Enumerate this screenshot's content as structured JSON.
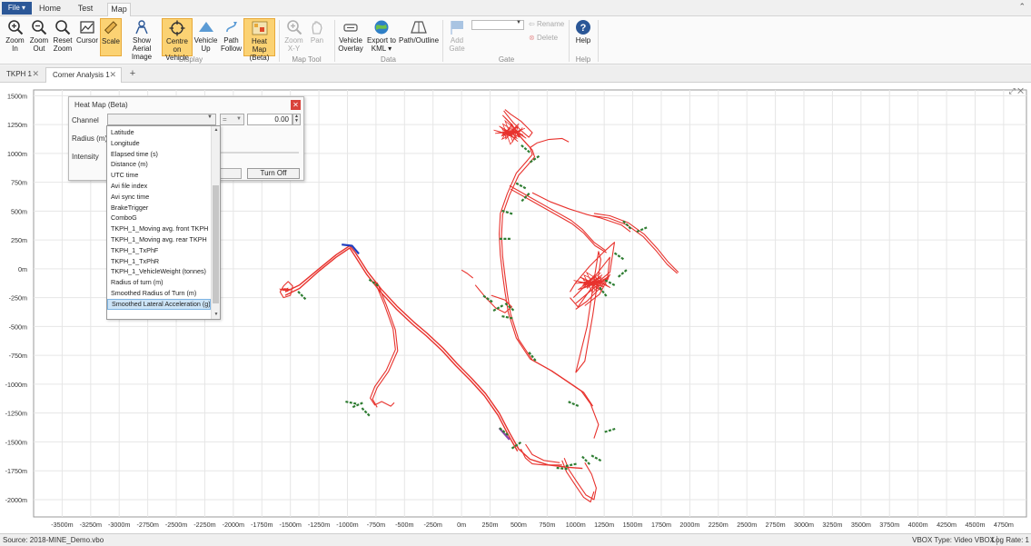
{
  "ribbon_tabs": {
    "file": "File ▾",
    "home": "Home",
    "test_setup": "Test Setup",
    "map": "Map",
    "collapse": "⌃"
  },
  "ribbon": {
    "zoom_in": [
      "Zoom",
      "In"
    ],
    "zoom_out": [
      "Zoom",
      "Out"
    ],
    "reset_zoom": [
      "Reset",
      "Zoom"
    ],
    "cursor": "Cursor",
    "scale": "Scale",
    "show_aerial": [
      "Show Aerial",
      "Image"
    ],
    "centre_on_vehicle": [
      "Centre on",
      "Vehicle"
    ],
    "vehicle_up": [
      "Vehicle",
      "Up"
    ],
    "path_follow": [
      "Path",
      "Follow"
    ],
    "heat_map": [
      "Heat Map",
      "(Beta)"
    ],
    "zoom_xy": [
      "Zoom",
      "X-Y"
    ],
    "pan": "Pan",
    "vehicle_overlay": [
      "Vehicle",
      "Overlay"
    ],
    "export_kml": [
      "Export to",
      "KML ▾"
    ],
    "path_outline": "Path/Outline",
    "add_gate": [
      "Add",
      "Gate"
    ],
    "rename": "Rename",
    "delete": "Delete",
    "help": "Help",
    "groups": {
      "display": "Display",
      "map_tool": "Map Tool",
      "data": "Data",
      "gate": "Gate",
      "help": "Help"
    }
  },
  "doc_tabs": {
    "tab1": "TKPH 1",
    "tab2": "Corner Analysis 1",
    "close": "✕",
    "add": "+"
  },
  "heat_map_dialog": {
    "title": "Heat Map (Beta)",
    "close": "✕",
    "channel_label": "Channel",
    "radius_label": "Radius (m)",
    "intensity_label": "Intensity",
    "operator": "=",
    "value": "0.00",
    "turn_off": "Turn Off"
  },
  "channel_options": [
    "Latitude",
    "Longitude",
    "Elapsed time (s)",
    "Distance (m)",
    "UTC time",
    "Avi file index",
    "Avi sync time",
    "BrakeTrigger",
    "ComboG",
    "TKPH_1_Moving avg. front TKPH",
    "TKPH_1_Moving avg. rear TKPH",
    "TKPH_1_TxPhF",
    "TKPH_1_TxPhR",
    "TKPH_1_VehicleWeight (tonnes)",
    "Radius of turn (m)",
    "Smoothed Radius of Turn (m)",
    "Smoothed Lateral Acceleration (g)"
  ],
  "selected_channel_index": 16,
  "map": {
    "x_axis_ticks": [
      "-3500m",
      "-3250m",
      "-3000m",
      "-2750m",
      "-2500m",
      "-2250m",
      "-2000m",
      "-1750m",
      "-1500m",
      "-1250m",
      "-1000m",
      "-750m",
      "-500m",
      "-250m",
      "0m",
      "250m",
      "500m",
      "750m",
      "1000m",
      "1250m",
      "1500m",
      "1750m",
      "2000m",
      "2250m",
      "2500m",
      "2750m",
      "3000m",
      "3250m",
      "3500m",
      "3750m",
      "4000m",
      "4250m",
      "4500m",
      "4750m"
    ],
    "y_axis_ticks": [
      "1500m",
      "1250m",
      "1000m",
      "750m",
      "500m",
      "250m",
      "0m",
      "-250m",
      "-500m",
      "-750m",
      "-1000m",
      "-1250m",
      "-1500m",
      "-1750m",
      "-2000m"
    ],
    "x_range": [
      -3750,
      4950
    ],
    "y_range": [
      -2150,
      1550
    ],
    "grid": true,
    "colors": {
      "track": "#e8322d",
      "gate": "#2e7d32",
      "highlight_blue": "#1f3fbf",
      "highlight_purple": "#8e44ad"
    },
    "view_controls": "⤢ ✕"
  },
  "status": {
    "source": "Source: 2018-MINE_Demo.vbo",
    "vbox_type": "VBOX Type: Video VBOX",
    "log_rate": "Log Rate: 1"
  }
}
